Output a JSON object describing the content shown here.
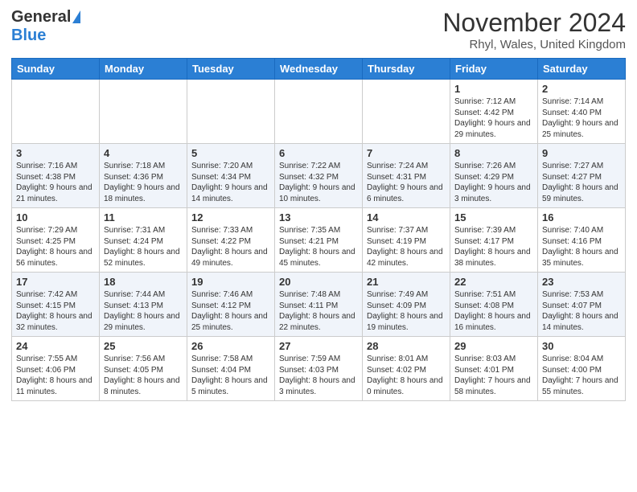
{
  "logo": {
    "general": "General",
    "blue": "Blue"
  },
  "title": "November 2024",
  "location": "Rhyl, Wales, United Kingdom",
  "days_of_week": [
    "Sunday",
    "Monday",
    "Tuesday",
    "Wednesday",
    "Thursday",
    "Friday",
    "Saturday"
  ],
  "weeks": [
    [
      {
        "day": "",
        "info": ""
      },
      {
        "day": "",
        "info": ""
      },
      {
        "day": "",
        "info": ""
      },
      {
        "day": "",
        "info": ""
      },
      {
        "day": "",
        "info": ""
      },
      {
        "day": "1",
        "info": "Sunrise: 7:12 AM\nSunset: 4:42 PM\nDaylight: 9 hours\nand 29 minutes."
      },
      {
        "day": "2",
        "info": "Sunrise: 7:14 AM\nSunset: 4:40 PM\nDaylight: 9 hours\nand 25 minutes."
      }
    ],
    [
      {
        "day": "3",
        "info": "Sunrise: 7:16 AM\nSunset: 4:38 PM\nDaylight: 9 hours\nand 21 minutes."
      },
      {
        "day": "4",
        "info": "Sunrise: 7:18 AM\nSunset: 4:36 PM\nDaylight: 9 hours\nand 18 minutes."
      },
      {
        "day": "5",
        "info": "Sunrise: 7:20 AM\nSunset: 4:34 PM\nDaylight: 9 hours\nand 14 minutes."
      },
      {
        "day": "6",
        "info": "Sunrise: 7:22 AM\nSunset: 4:32 PM\nDaylight: 9 hours\nand 10 minutes."
      },
      {
        "day": "7",
        "info": "Sunrise: 7:24 AM\nSunset: 4:31 PM\nDaylight: 9 hours\nand 6 minutes."
      },
      {
        "day": "8",
        "info": "Sunrise: 7:26 AM\nSunset: 4:29 PM\nDaylight: 9 hours\nand 3 minutes."
      },
      {
        "day": "9",
        "info": "Sunrise: 7:27 AM\nSunset: 4:27 PM\nDaylight: 8 hours\nand 59 minutes."
      }
    ],
    [
      {
        "day": "10",
        "info": "Sunrise: 7:29 AM\nSunset: 4:25 PM\nDaylight: 8 hours\nand 56 minutes."
      },
      {
        "day": "11",
        "info": "Sunrise: 7:31 AM\nSunset: 4:24 PM\nDaylight: 8 hours\nand 52 minutes."
      },
      {
        "day": "12",
        "info": "Sunrise: 7:33 AM\nSunset: 4:22 PM\nDaylight: 8 hours\nand 49 minutes."
      },
      {
        "day": "13",
        "info": "Sunrise: 7:35 AM\nSunset: 4:21 PM\nDaylight: 8 hours\nand 45 minutes."
      },
      {
        "day": "14",
        "info": "Sunrise: 7:37 AM\nSunset: 4:19 PM\nDaylight: 8 hours\nand 42 minutes."
      },
      {
        "day": "15",
        "info": "Sunrise: 7:39 AM\nSunset: 4:17 PM\nDaylight: 8 hours\nand 38 minutes."
      },
      {
        "day": "16",
        "info": "Sunrise: 7:40 AM\nSunset: 4:16 PM\nDaylight: 8 hours\nand 35 minutes."
      }
    ],
    [
      {
        "day": "17",
        "info": "Sunrise: 7:42 AM\nSunset: 4:15 PM\nDaylight: 8 hours\nand 32 minutes."
      },
      {
        "day": "18",
        "info": "Sunrise: 7:44 AM\nSunset: 4:13 PM\nDaylight: 8 hours\nand 29 minutes."
      },
      {
        "day": "19",
        "info": "Sunrise: 7:46 AM\nSunset: 4:12 PM\nDaylight: 8 hours\nand 25 minutes."
      },
      {
        "day": "20",
        "info": "Sunrise: 7:48 AM\nSunset: 4:11 PM\nDaylight: 8 hours\nand 22 minutes."
      },
      {
        "day": "21",
        "info": "Sunrise: 7:49 AM\nSunset: 4:09 PM\nDaylight: 8 hours\nand 19 minutes."
      },
      {
        "day": "22",
        "info": "Sunrise: 7:51 AM\nSunset: 4:08 PM\nDaylight: 8 hours\nand 16 minutes."
      },
      {
        "day": "23",
        "info": "Sunrise: 7:53 AM\nSunset: 4:07 PM\nDaylight: 8 hours\nand 14 minutes."
      }
    ],
    [
      {
        "day": "24",
        "info": "Sunrise: 7:55 AM\nSunset: 4:06 PM\nDaylight: 8 hours\nand 11 minutes."
      },
      {
        "day": "25",
        "info": "Sunrise: 7:56 AM\nSunset: 4:05 PM\nDaylight: 8 hours\nand 8 minutes."
      },
      {
        "day": "26",
        "info": "Sunrise: 7:58 AM\nSunset: 4:04 PM\nDaylight: 8 hours\nand 5 minutes."
      },
      {
        "day": "27",
        "info": "Sunrise: 7:59 AM\nSunset: 4:03 PM\nDaylight: 8 hours\nand 3 minutes."
      },
      {
        "day": "28",
        "info": "Sunrise: 8:01 AM\nSunset: 4:02 PM\nDaylight: 8 hours\nand 0 minutes."
      },
      {
        "day": "29",
        "info": "Sunrise: 8:03 AM\nSunset: 4:01 PM\nDaylight: 7 hours\nand 58 minutes."
      },
      {
        "day": "30",
        "info": "Sunrise: 8:04 AM\nSunset: 4:00 PM\nDaylight: 7 hours\nand 55 minutes."
      }
    ]
  ]
}
